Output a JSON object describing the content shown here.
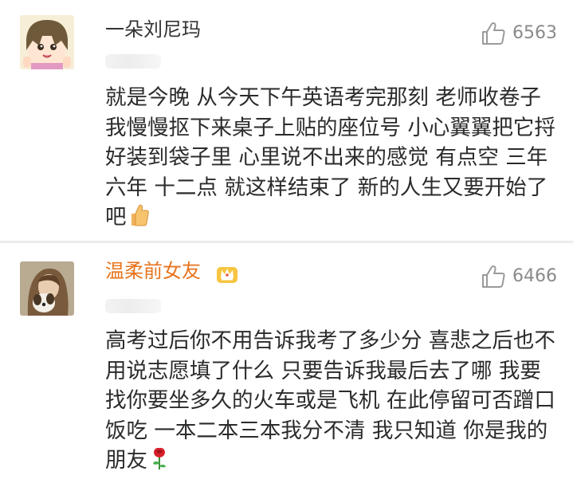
{
  "comments": [
    {
      "username": "一朵刘尼玛",
      "likes": "6563",
      "text": "就是今晚 从今天下午英语考完那刻 老师收卷子 我慢慢抠下来桌子上贴的座位号 小心翼翼把它捋好装到袋子里 心里说不出来的感觉 有点空 三年 六年 十二点 就这样结束了 新的人生又要开始了吧",
      "trailing_icon": "thumbs-up-emoji"
    },
    {
      "username": "温柔前女友",
      "likes": "6466",
      "text": "高考过后你不用告诉我考了多少分 喜悲之后也不用说志愿填了什么 只要告诉我最后去了哪 我要找你要坐多久的火车或是飞机 在此停留可否蹭口饭吃 一本二本三本我分不清 我只知道 你是我的朋友",
      "trailing_icon": "rose-emoji",
      "badge_icon": "vip-crown-icon"
    }
  ],
  "colors": {
    "username_default": "#333333",
    "username_vip": "#e8731c",
    "like_count": "#8a8a8a",
    "body_text": "#2b2b2b"
  }
}
